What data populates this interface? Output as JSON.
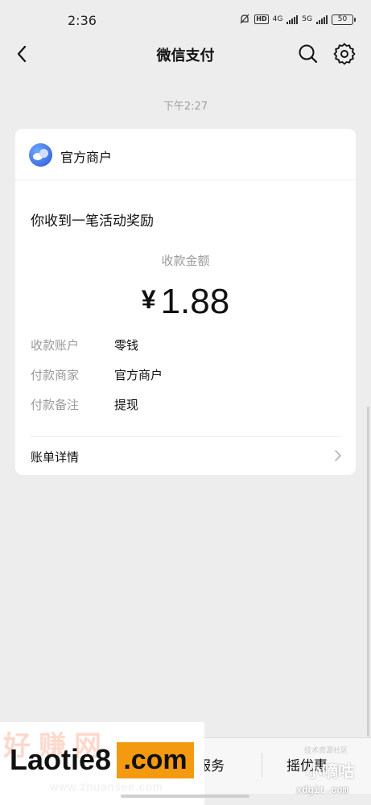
{
  "status_bar": {
    "time": "2:36",
    "hd": "HD",
    "net1": "4G",
    "net2": "5G",
    "battery": "50"
  },
  "nav": {
    "title": "微信支付",
    "back_icon": "chevron-left-icon",
    "search_icon": "search-icon",
    "settings_icon": "gear-icon"
  },
  "message": {
    "timestamp": "下午2:27",
    "merchant_name": "官方商户",
    "subtitle": "你收到一笔活动奖励",
    "amount_label": "收款金额",
    "currency": "¥",
    "amount": "1.88",
    "details": [
      {
        "key": "收款账户",
        "value": "零钱"
      },
      {
        "key": "付款商家",
        "value": "官方商户"
      },
      {
        "key": "付款备注",
        "value": "提现"
      }
    ],
    "bill_details_label": "账单详情"
  },
  "bottom_menu": {
    "items": [
      "付服务",
      "摇优惠"
    ]
  },
  "watermarks": {
    "left_main": "Laotie8",
    "left_dotcom": ".com",
    "left_bg": "好赚网",
    "left_url": "www.zhuansee.com",
    "right_small": "技术资源社区",
    "right_big": "小嘀咕",
    "right_url": "xdgit.com"
  },
  "colors": {
    "background": "#ededed",
    "card": "#ffffff",
    "muted_text": "#9a9a9a",
    "accent_orange": "#f39a10"
  }
}
